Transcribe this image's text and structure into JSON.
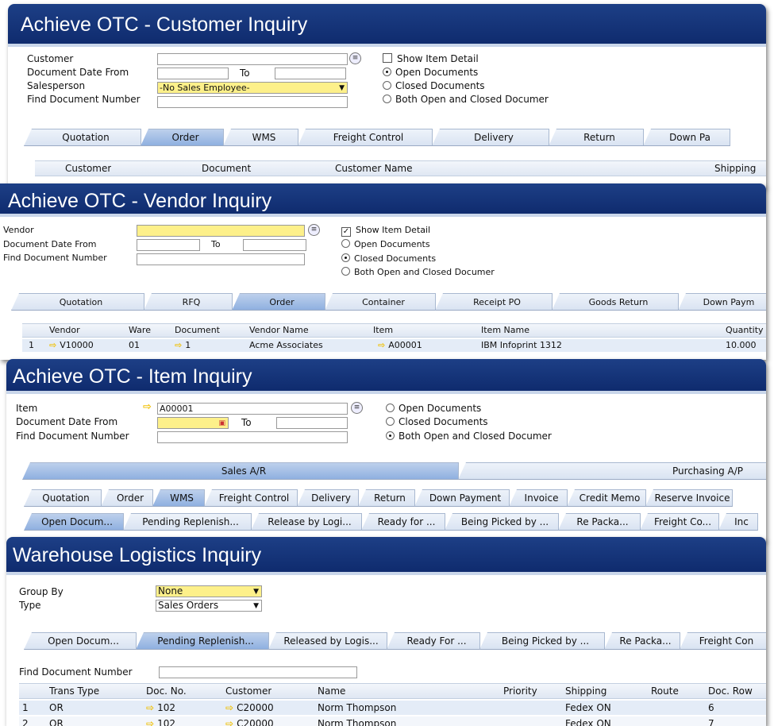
{
  "customer": {
    "title": "Achieve OTC - Customer Inquiry",
    "labels": {
      "customer": "Customer",
      "date_from": "Document Date From",
      "to": "To",
      "salesperson": "Salesperson",
      "find": "Find Document Number"
    },
    "salesperson_value": "-No Sales Employee-",
    "options": {
      "item_detail": "Show Item Detail",
      "open": "Open Documents",
      "closed": "Closed Documents",
      "both": "Both Open and Closed Documer"
    },
    "tabs": [
      "Quotation",
      "Order",
      "WMS",
      "Freight Control",
      "Delivery",
      "Return",
      "Down Pa"
    ],
    "columns": [
      "Customer",
      "Document",
      "Customer Name",
      "Shipping"
    ]
  },
  "vendor": {
    "title": "Achieve OTC - Vendor Inquiry",
    "labels": {
      "vendor": "Vendor",
      "date_from": "Document Date From",
      "to": "To",
      "find": "Find Document Number"
    },
    "options": {
      "item_detail": "Show Item Detail",
      "open": "Open Documents",
      "closed": "Closed Documents",
      "both": "Both Open and Closed Documer"
    },
    "tabs": [
      "Quotation",
      "RFQ",
      "Order",
      "Container",
      "Receipt PO",
      "Goods Return",
      "Down Paym"
    ],
    "columns": [
      "Vendor",
      "Ware",
      "Document",
      "Vendor Name",
      "Item",
      "Item Name",
      "Quantity"
    ],
    "row": {
      "num": "1",
      "vendor": "V10000",
      "ware": "01",
      "document": "1",
      "vendor_name": "Acme Associates",
      "item": "A00001",
      "item_name": "IBM Infoprint 1312",
      "quantity": "10.000"
    }
  },
  "item": {
    "title": "Achieve OTC - Item Inquiry",
    "labels": {
      "item": "Item",
      "date_from": "Document Date From",
      "to": "To",
      "find": "Find Document Number"
    },
    "item_value": "A00001",
    "options": {
      "open": "Open Documents",
      "closed": "Closed Documents",
      "both": "Both Open and Closed Documer"
    },
    "top_tabs": [
      "Sales A/R",
      "Purchasing A/P"
    ],
    "tabs": [
      "Quotation",
      "Order",
      "WMS",
      "Freight Control",
      "Delivery",
      "Return",
      "Down Payment",
      "Invoice",
      "Credit Memo",
      "Reserve Invoice"
    ],
    "subtabs": [
      "Open Docum...",
      "Pending Replenish...",
      "Release by Logi...",
      "Ready for ...",
      "Being Picked by ...",
      "Re Packa...",
      "Freight Co...",
      "Inc"
    ]
  },
  "warehouse": {
    "title": "Warehouse Logistics Inquiry",
    "labels": {
      "group_by": "Group By",
      "type": "Type",
      "find": "Find Document Number"
    },
    "group_value": "None",
    "type_value": "Sales Orders",
    "tabs": [
      "Open Docum...",
      "Pending Replenish...",
      "Released by Logis...",
      "Ready For ...",
      "Being Picked by ...",
      "Re Packa...",
      "Freight Con"
    ],
    "columns": [
      "Trans Type",
      "Doc. No.",
      "Customer",
      "Name",
      "Priority",
      "Shipping",
      "Route",
      "Doc. Row"
    ],
    "rows": [
      {
        "num": "1",
        "type": "OR",
        "doc": "102",
        "customer": "C20000",
        "name": "Norm Thompson",
        "shipping": "Fedex ON",
        "row": "6"
      },
      {
        "num": "2",
        "type": "OR",
        "doc": "102",
        "customer": "C20000",
        "name": "Norm Thompson",
        "shipping": "Fedex ON",
        "row": "7"
      }
    ]
  },
  "colors": {
    "titlebar": "#1d3f86",
    "highlight": "#fdf08a",
    "active_tab": "#9bb8e4",
    "arrow": "#f0c000"
  }
}
